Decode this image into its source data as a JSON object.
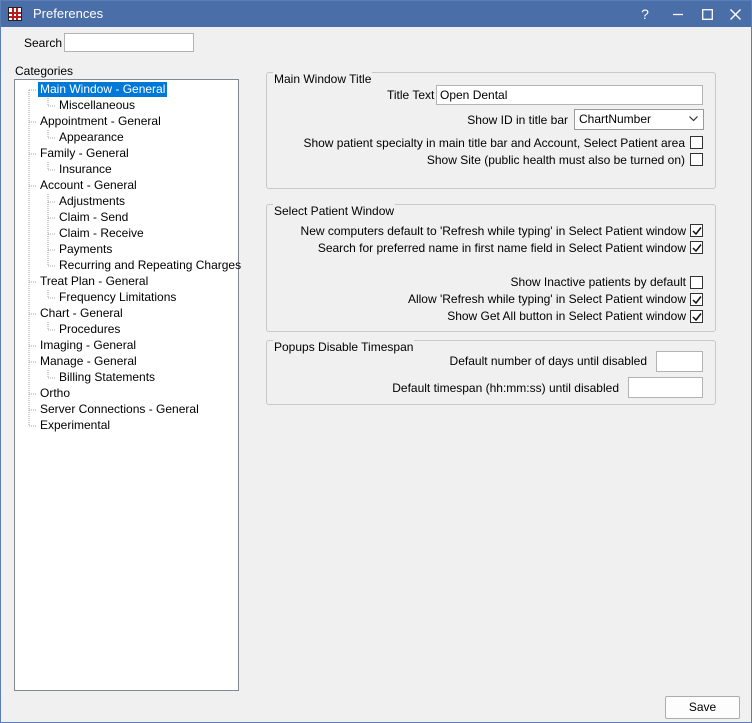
{
  "window": {
    "title": "Preferences",
    "help_glyph": "?",
    "min_icon": "minimize-icon",
    "max_icon": "maximize-icon",
    "close_icon": "close-icon"
  },
  "search": {
    "label": "Search",
    "value": ""
  },
  "categories": {
    "label": "Categories",
    "items": [
      {
        "label": "Main Window - General",
        "level": 0,
        "selected": true
      },
      {
        "label": "Miscellaneous",
        "level": 1
      },
      {
        "label": "Appointment - General",
        "level": 0
      },
      {
        "label": "Appearance",
        "level": 1
      },
      {
        "label": "Family - General",
        "level": 0
      },
      {
        "label": "Insurance",
        "level": 1
      },
      {
        "label": "Account - General",
        "level": 0
      },
      {
        "label": "Adjustments",
        "level": 1
      },
      {
        "label": "Claim - Send",
        "level": 1
      },
      {
        "label": "Claim - Receive",
        "level": 1
      },
      {
        "label": "Payments",
        "level": 1
      },
      {
        "label": "Recurring and Repeating Charges",
        "level": 1
      },
      {
        "label": "Treat Plan - General",
        "level": 0
      },
      {
        "label": "Frequency Limitations",
        "level": 1
      },
      {
        "label": "Chart - General",
        "level": 0
      },
      {
        "label": "Procedures",
        "level": 1
      },
      {
        "label": "Imaging - General",
        "level": 0
      },
      {
        "label": "Manage - General",
        "level": 0
      },
      {
        "label": "Billing Statements",
        "level": 1
      },
      {
        "label": "Ortho",
        "level": 0
      },
      {
        "label": "Server Connections - General",
        "level": 0
      },
      {
        "label": "Experimental",
        "level": 0
      }
    ]
  },
  "main_window_title": {
    "group_title": "Main Window Title",
    "title_text_label": "Title Text",
    "title_text_value": "Open Dental",
    "show_id_label": "Show ID in title bar",
    "show_id_value": "ChartNumber",
    "specialty_label": "Show patient specialty in main title bar and Account, Select Patient area",
    "specialty_checked": false,
    "show_site_label": "Show Site (public health must also be turned on)",
    "show_site_checked": false
  },
  "select_patient": {
    "group_title": "Select Patient Window",
    "new_computers_label": "New computers default to 'Refresh while typing' in Select Patient window",
    "new_computers_checked": true,
    "preferred_name_label": "Search for preferred name in first name field in Select Patient window",
    "preferred_name_checked": true,
    "inactive_label": "Show Inactive patients by default",
    "inactive_checked": false,
    "allow_refresh_label": "Allow 'Refresh while typing' in Select Patient window",
    "allow_refresh_checked": true,
    "get_all_label": "Show Get All button in Select Patient window",
    "get_all_checked": true
  },
  "popups": {
    "group_title": "Popups Disable Timespan",
    "days_label": "Default number of days until disabled",
    "days_value": "",
    "timespan_label": "Default timespan (hh:mm:ss) until disabled",
    "timespan_value": ""
  },
  "footer": {
    "save_label": "Save"
  }
}
